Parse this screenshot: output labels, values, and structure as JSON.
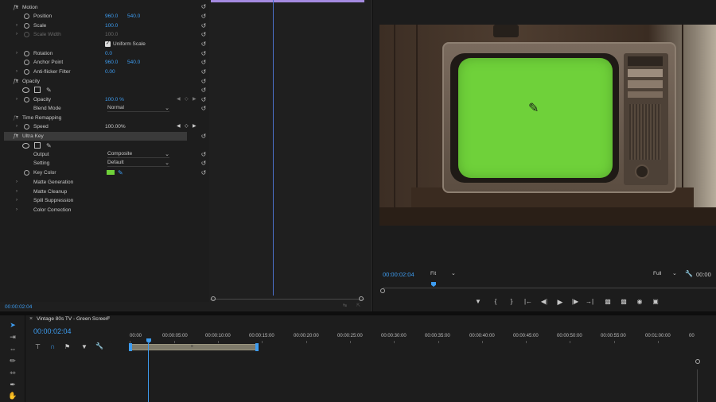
{
  "effect_controls": {
    "motion": {
      "label": "Motion",
      "position": {
        "label": "Position",
        "x": "960.0",
        "y": "540.0"
      },
      "scale": {
        "label": "Scale",
        "value": "100.0"
      },
      "scale_width": {
        "label": "Scale Width",
        "value": "100.0"
      },
      "uniform_scale": {
        "label": "Uniform Scale",
        "checked": true
      },
      "rotation": {
        "label": "Rotation",
        "value": "0.0"
      },
      "anchor_point": {
        "label": "Anchor Point",
        "x": "960.0",
        "y": "540.0"
      },
      "anti_flicker": {
        "label": "Anti-flicker Filter",
        "value": "0.00"
      }
    },
    "opacity": {
      "label": "Opacity",
      "opacity_row": {
        "label": "Opacity",
        "value": "100.0 %"
      },
      "blend_mode": {
        "label": "Blend Mode",
        "value": "Normal"
      }
    },
    "time_remapping": {
      "label": "Time Remapping",
      "speed": {
        "label": "Speed",
        "value": "100.00%"
      }
    },
    "ultra_key": {
      "label": "Ultra Key",
      "output": {
        "label": "Output",
        "value": "Composite"
      },
      "setting": {
        "label": "Setting",
        "value": "Default"
      },
      "key_color": {
        "label": "Key Color",
        "color": "#6fd13a"
      },
      "groups": [
        "Matte Generation",
        "Matte Cleanup",
        "Spill Suppression",
        "Color Correction"
      ]
    },
    "timecode": "00:00:02:04",
    "accent_color": "#3d9cf0"
  },
  "program_monitor": {
    "timecode": "00:00:02:04",
    "zoom": "Fit",
    "resolution": "Full",
    "timecode_right": "00:00"
  },
  "timeline": {
    "sequence_name": "Vintage 80s TV - Green Screen",
    "timecode": "00:00:02:04",
    "ruler": [
      "00:00",
      "00:00:05:00",
      "00:00:10:00",
      "00:00:15:00",
      "00:00:20:00",
      "00:00:25:00",
      "00:00:30:00",
      "00:00:35:00",
      "00:00:40:00",
      "00:00:45:00",
      "00:00:50:00",
      "00:00:55:00",
      "00:01:00:00",
      "00"
    ]
  },
  "icons": {
    "reset": "reset-icon",
    "eyedropper": "eyedropper-icon",
    "pen": "pen-icon"
  }
}
